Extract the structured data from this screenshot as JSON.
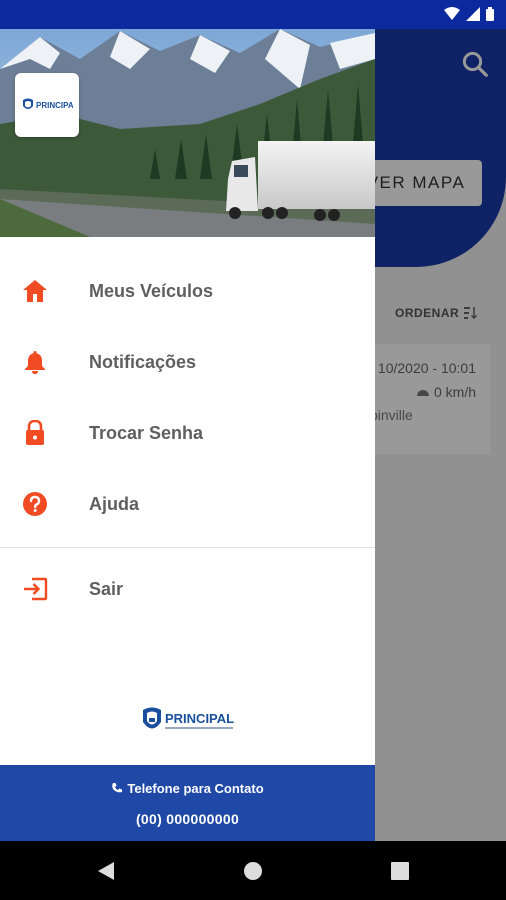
{
  "app": {
    "ver_mapa_label": "VER MAPA",
    "ordenar_label": "ORDENAR",
    "vehicle": {
      "datetime": "10/2020 - 10:01",
      "speed": "0 km/h",
      "city": "oinville"
    }
  },
  "drawer": {
    "brand": "PRINCIPAL",
    "menu": [
      {
        "label": "Meus Veículos",
        "icon": "home-icon"
      },
      {
        "label": "Notificações",
        "icon": "bell-icon"
      },
      {
        "label": "Trocar Senha",
        "icon": "lock-icon"
      },
      {
        "label": "Ajuda",
        "icon": "help-icon"
      },
      {
        "label": "Sair",
        "icon": "exit-icon"
      }
    ],
    "contact": {
      "label": "Telefone para Contato",
      "phone": "(00) 000000000"
    }
  },
  "colors": {
    "primary": "#1a3aa8",
    "accent": "#f04b23",
    "contact_bar": "#2048a6"
  }
}
